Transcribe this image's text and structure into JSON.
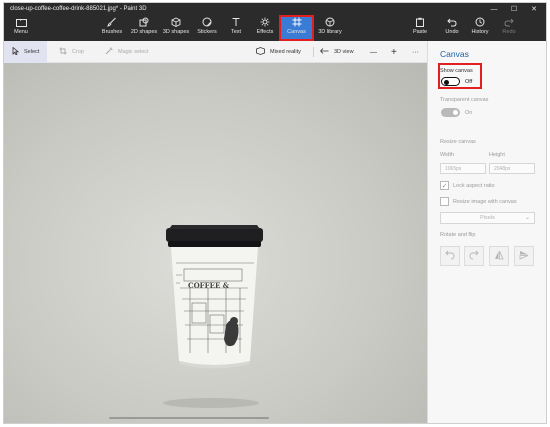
{
  "window": {
    "title": "close-up-coffee-coffee-drink-885021.jpg* - Paint 3D",
    "controls": [
      "—",
      "☐",
      "✕"
    ]
  },
  "ribbon": {
    "menu": "Menu",
    "tools": [
      "Brushes",
      "2D shapes",
      "3D shapes",
      "Stickers",
      "Text",
      "Effects",
      "Canvas",
      "3D library"
    ],
    "active_tool": "Canvas",
    "paste": "Paste",
    "undo": "Undo",
    "history": "History",
    "redo": "Redo"
  },
  "command_bar": {
    "select": "Select",
    "crop": "Crop",
    "magic_select": "Magic select",
    "mixed_reality": "Mixed reality",
    "view_3d": "3D view",
    "zoom_out": "—",
    "zoom_in": "+",
    "more": "···"
  },
  "canvas_image": {
    "cup_text": "COFFEE &"
  },
  "panel": {
    "title": "Canvas",
    "show_canvas": {
      "label": "Show canvas",
      "state": "Off"
    },
    "transparent_canvas": {
      "label": "Transparent canvas",
      "state": "On"
    },
    "resize_canvas": "Resize canvas",
    "width_label": "Width",
    "height_label": "Height",
    "width_value": "1065px",
    "height_value": "2048px",
    "lock_aspect": "Lock aspect ratio",
    "resize_image": "Resize image with canvas",
    "units": "Pixels",
    "rotate_flip": "Rotate and flip"
  },
  "colors": {
    "accent": "#3a7bd5",
    "highlight": "#e02020",
    "header": "#2b2b2b",
    "panel_title": "#1f5fa8"
  }
}
